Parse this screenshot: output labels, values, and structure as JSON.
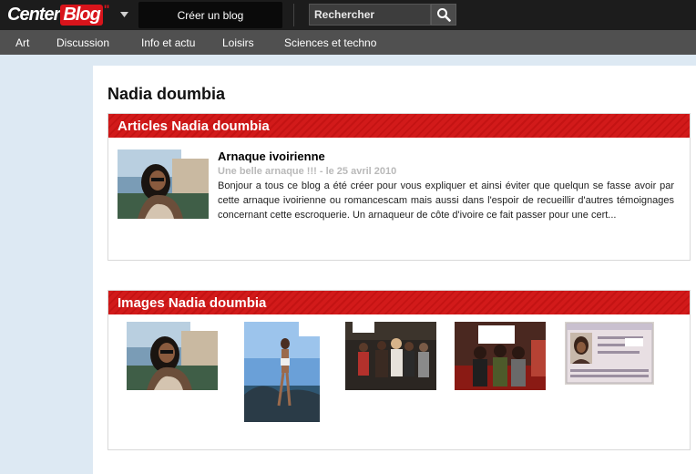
{
  "header": {
    "logo_center": "Center",
    "logo_blog": "Blog",
    "logo_tick": "\"",
    "create_label": "Créer un blog",
    "search_placeholder": "Rechercher"
  },
  "nav": {
    "items": [
      "Art",
      "Discussion",
      "Info et actu",
      "Loisirs",
      "Sciences et techno"
    ]
  },
  "page": {
    "title": "Nadia doumbia"
  },
  "articles": {
    "heading": "Articles Nadia doumbia",
    "items": [
      {
        "title": "Arnaque ivoirienne",
        "meta": "Une belle arnaque !!! - le 25 avril 2010",
        "excerpt": "Bonjour a tous ce blog a été créer pour vous expliquer et ainsi éviter que quelqun se fasse avoir par cette arnaque ivoirienne ou romancescam mais aussi dans l'espoir de recueillir d'autres témoignages concernant cette escroquerie. Un arnaqueur de côte d'ivoire ce fait passer pour une cert..."
      }
    ]
  },
  "images": {
    "heading": "Images Nadia doumbia"
  },
  "colors": {
    "accent_red": "#d21a1a",
    "topbar": "#1c1c1c",
    "nav": "#505050",
    "background": "#dde9f3"
  }
}
